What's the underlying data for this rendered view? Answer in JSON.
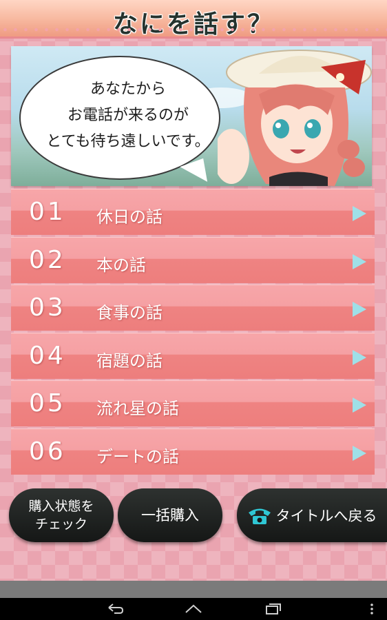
{
  "header": {
    "title": "なにを話す？"
  },
  "banner": {
    "speech_lines": [
      "あなたから",
      "お電話が来るのが",
      "とても待ち遠しいです。"
    ]
  },
  "menu": {
    "items": [
      {
        "number": "01",
        "label": "休日の話"
      },
      {
        "number": "02",
        "label": "本の話"
      },
      {
        "number": "03",
        "label": "食事の話"
      },
      {
        "number": "04",
        "label": "宿題の話"
      },
      {
        "number": "05",
        "label": "流れ星の話"
      },
      {
        "number": "06",
        "label": "デートの話"
      }
    ],
    "arrow_icon": "play-arrow-icon",
    "arrow_color": "#9fe0e8"
  },
  "buttons": {
    "check_line1": "購入状態を",
    "check_line2": "チェック",
    "bulk": "一括購入",
    "title": "タイトルへ戻る",
    "title_icon": "phone-icon",
    "title_icon_color": "#2fc7d4"
  },
  "navbar": {
    "icons": [
      "back-icon",
      "home-icon",
      "recent-apps-icon",
      "menu-overflow-icon"
    ]
  },
  "colors": {
    "background": "#eaa4b0",
    "menu_item": "#f09090",
    "button": "#1e2120"
  }
}
